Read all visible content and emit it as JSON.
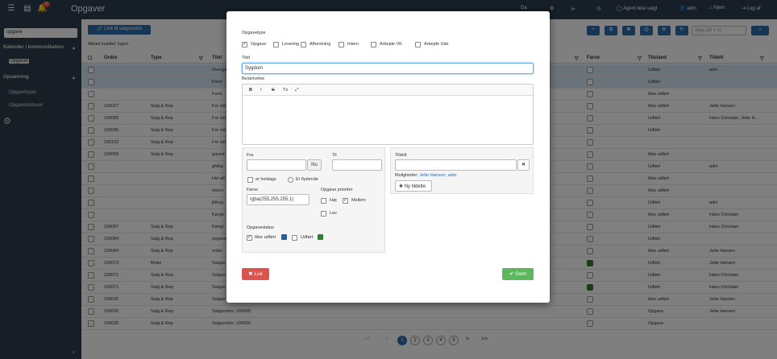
{
  "app": {
    "title": "Opgaver",
    "notif_count": "11",
    "topbar_badge": "0"
  },
  "topnav": {
    "lang": "Da",
    "agent": "Agent ikke valgt",
    "user": "adm",
    "home": "Hjem",
    "logout": "Log af"
  },
  "sidebar": {
    "search": "opgave",
    "section1": "Kalender / kommunikation",
    "item1": "Opgaver",
    "section2": "Opsætning",
    "item2": "Opgavetyper",
    "item3": "Opgavestatuser"
  },
  "main": {
    "link_button": "Link til salgsordre",
    "subtitle": "Aktuel kvalitet: ingen",
    "search_placeholder": "Søg (alt + s)"
  },
  "columns": [
    "Ordre",
    "Type",
    "Titel",
    "Farve",
    "Tilstand",
    "Tildelt"
  ],
  "rows": [
    [
      "",
      "",
      "Overgang",
      "",
      "Udført",
      "adm"
    ],
    [
      "",
      "",
      "Forsl",
      "",
      "Udført",
      ""
    ],
    [
      "",
      "",
      "Forsl",
      "",
      "Ikke udført",
      ""
    ],
    [
      "190027",
      "Salg & Rep",
      "For vid",
      "",
      "Ikke udført",
      "Jette Hansen"
    ],
    [
      "190083",
      "Salg & Rep",
      "For vid",
      "",
      "Udført",
      "Hans Christian, Jette H..."
    ],
    [
      "190085",
      "Salg & Rep",
      "For vid",
      "",
      "Udført",
      ""
    ],
    [
      "190102",
      "Salg & Rep",
      "For vid",
      "",
      "",
      ""
    ],
    [
      "190055",
      "Salg & Rep",
      "garant",
      "",
      "Ikke udført",
      ""
    ],
    [
      "",
      "",
      "gfdhg",
      "",
      "Udført",
      "adm"
    ],
    [
      "",
      "",
      "Hei att",
      "",
      "Ikke udført",
      ""
    ],
    [
      "",
      "",
      "intern",
      "",
      "Ikke udført",
      ""
    ],
    [
      "",
      "",
      "jklkvg",
      "",
      "Udført",
      "adm"
    ],
    [
      "",
      "",
      "Kørgo",
      "",
      "Ikke udført",
      "Hans Christian"
    ],
    [
      "190087",
      "Salg & Rep",
      "Kørgo",
      "",
      "Udført",
      "Hans Christian"
    ],
    [
      "190084",
      "Salg & Rep",
      "opgave",
      "",
      "Udført",
      ""
    ],
    [
      "190084",
      "Salg & Rep",
      "ordre",
      "",
      "Ikke udført",
      "Jette Hansen"
    ],
    [
      "190073",
      "Motel",
      "Salgso",
      "green",
      "Udført",
      "Jette Hansen"
    ],
    [
      "190071",
      "Salg & Rep",
      "Salgso",
      "",
      "Udført",
      "Hans Christian"
    ],
    [
      "190071",
      "Salg & Rep",
      "Salgso",
      "green",
      "Udført",
      "Hans Christian"
    ],
    [
      "190035",
      "Salg & Rep",
      "Salgso",
      "",
      "Ikke udført",
      "Jette Hansen"
    ],
    [
      "190035",
      "Salg & Rep",
      "Salgsordre: 190035",
      "",
      "Opgave",
      "Jette Hansen"
    ],
    [
      "190035",
      "Salg & Rep",
      "Salgsordre: 190035",
      "",
      "Opgave",
      ""
    ]
  ],
  "pager": {
    "first": "<<",
    "prev": "<",
    "pages": [
      "1",
      "2",
      "3",
      "4",
      "5"
    ],
    "next": ">",
    "last": ">>"
  },
  "modal": {
    "types_label": "Opgavetype",
    "types": [
      "Opgave",
      "Levering",
      "Afhentning",
      "Intern",
      "Arbejde VK",
      "Arbejde Ude"
    ],
    "title_label": "Titel",
    "title_value": "Sygdom",
    "desc_label": "Beskrivelse",
    "from_label": "Fra",
    "now_button": "Nu",
    "to_label": "Til",
    "allday_label": "er heldags",
    "recurring_label": "Er flydende",
    "color_label": "Farve",
    "color_value": "rgba(255,255,255,1)",
    "prio_label": "Opgave prioritet",
    "prio": [
      "Høj",
      "Mellem",
      "Lav"
    ],
    "status_label": "Opgavestatus",
    "status": [
      "Ikke udført",
      "Udført"
    ],
    "assigned_label": "Tildelt",
    "options_label": "Muligheder:",
    "options_value": "Jette Hansen, adm",
    "new_assign_button": "Ny tildelte",
    "close_button": "Luk",
    "save_button": "Gem"
  },
  "colors": {
    "topbar": "#2c3e50",
    "primary": "#2f6aa8",
    "danger": "#d9534f",
    "success": "#5cb85c",
    "status_blue": "#1f5fa6",
    "status_green": "#2e7d32"
  }
}
